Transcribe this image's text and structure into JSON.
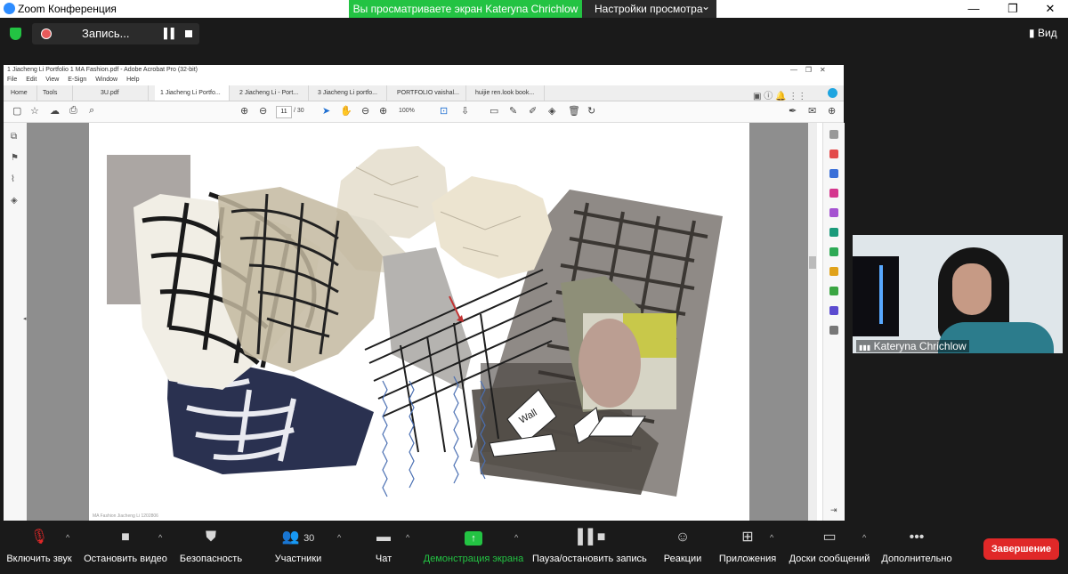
{
  "window": {
    "app_title": "Zoom Конференция",
    "minimize_label": "—",
    "maximize_label": "❐",
    "close_label": "✕"
  },
  "share_banner": {
    "viewing_text": "Вы просматриваете экран Kateryna Chrichlow",
    "view_options_label": "Настройки просмотра",
    "view_options_caret": "⌄"
  },
  "recording": {
    "label": "Запись...",
    "pause_icon": "▌▌"
  },
  "view_button": {
    "label": "▮ Вид"
  },
  "acrobat": {
    "title": "1 Jiacheng Li Portfolio 1 MA Fashion.pdf - Adobe Acrobat Pro (32-bit)",
    "menu": [
      "File",
      "Edit",
      "View",
      "E-Sign",
      "Window",
      "Help"
    ],
    "tabs": [
      "Home",
      "Tools",
      "3U.pdf",
      "1 Jiacheng Li Portfo...",
      "2 Jiacheng Li - Port...",
      "3 Jiacheng Li portfo...",
      "PORTFOLIO vaishal...",
      "huijie ren.look book..."
    ],
    "active_tab_index": 3,
    "page_current": "11",
    "page_total": "/ 30",
    "zoom": "100%",
    "page_footer": "MA Fashion Jiacheng Li 1202806"
  },
  "collage": {
    "wall_text": "Wall"
  },
  "participant": {
    "name": "Kateryna Chrichlow",
    "signal_icon": "▮▮▮"
  },
  "bottom_bar": {
    "mute_label": "Включить звук",
    "video_label": "Остановить видео",
    "security_label": "Безопасность",
    "participants_label": "Участники",
    "participants_count": "30",
    "chat_label": "Чат",
    "share_label": "Демонстрация экрана",
    "record_label": "Пауза/остановить запись",
    "reactions_label": "Реакции",
    "apps_label": "Приложения",
    "whiteboard_label": "Доски сообщений",
    "more_label": "Дополнительно",
    "end_label": "Завершение",
    "caret": "^"
  }
}
